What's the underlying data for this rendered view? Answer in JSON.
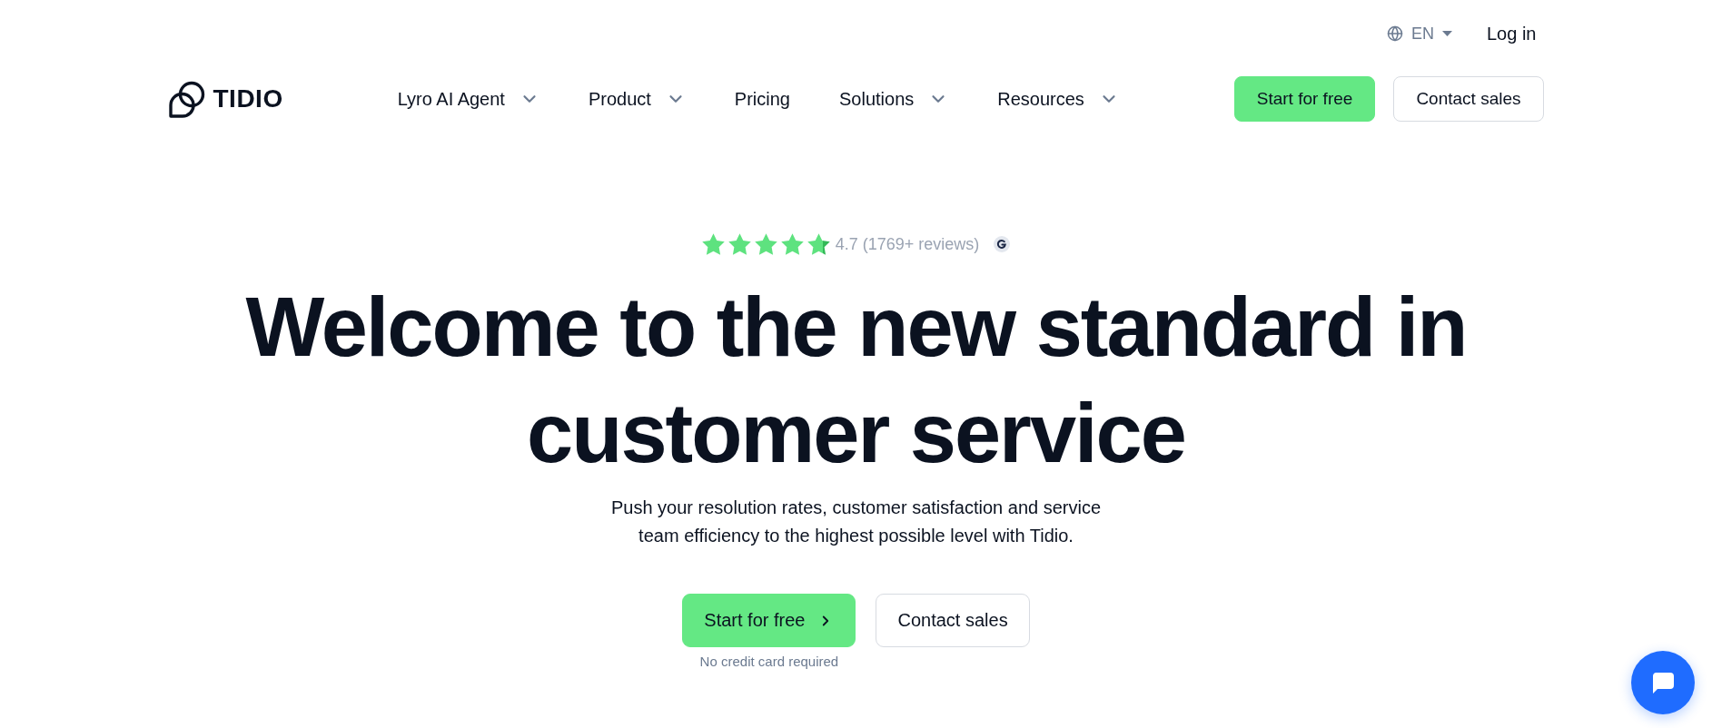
{
  "top_bar": {
    "language": "EN",
    "login": "Log in"
  },
  "header": {
    "logo": "TIDIO",
    "nav": [
      {
        "label": "Lyro AI Agent",
        "kind": "dropdown"
      },
      {
        "label": "Product",
        "kind": "dropdown"
      },
      {
        "label": "Pricing",
        "kind": "link"
      },
      {
        "label": "Solutions",
        "kind": "dropdown"
      },
      {
        "label": "Resources",
        "kind": "dropdown"
      }
    ],
    "buttons": [
      {
        "label": "Start for free",
        "kind": "primary"
      },
      {
        "label": "Contact sales",
        "kind": "secondary"
      }
    ]
  },
  "hero": {
    "rating": {
      "stars": 4.7,
      "text": "4.7 (1769+ reviews)"
    },
    "title": "Welcome to the new standard in customer service",
    "subtitle": "Push your resolution rates, customer satisfaction and service team efficiency to the highest possible level with Tidio.",
    "buttons": [
      {
        "label": "Start for free",
        "kind": "cta",
        "note": "No credit card required"
      },
      {
        "label": "Contact sales",
        "kind": "secondary"
      }
    ]
  }
}
